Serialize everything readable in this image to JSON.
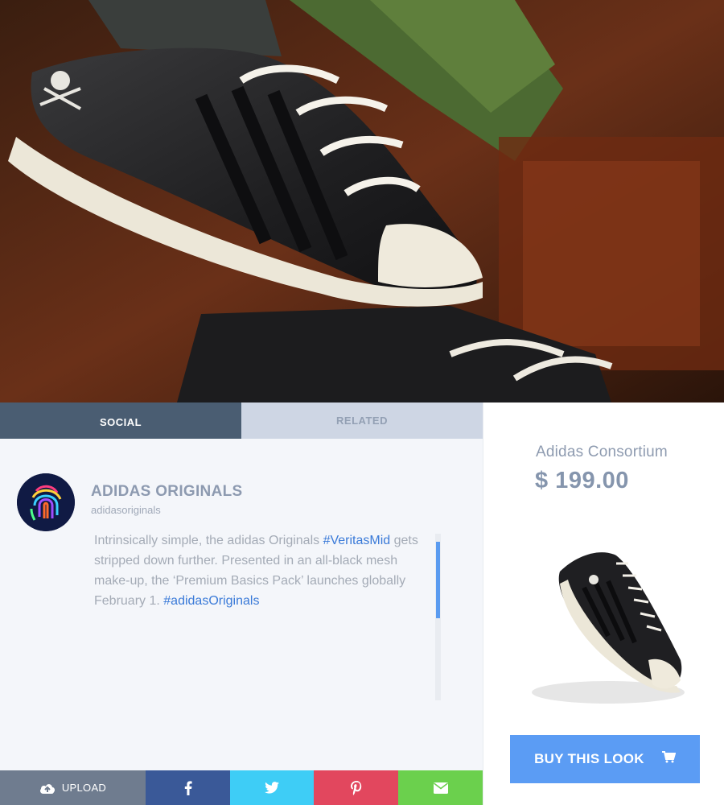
{
  "tabs": {
    "social": "SOCIAL",
    "related": "RELATED"
  },
  "profile": {
    "name": "ADIDAS ORIGINALS",
    "handle": "adidasoriginals"
  },
  "post": {
    "text_1": "Intrinsically simple, the adidas Originals ",
    "tag_1": "#VeritasMid",
    "text_2": " gets stripped down further. Presented in an all-black mesh make-up, the ‘Premium Basics Pack’ launches globally February 1. ",
    "tag_2": "#adidasOriginals"
  },
  "share": {
    "upload_label": "UPLOAD"
  },
  "product": {
    "name": "Adidas Consortium",
    "price": "$ 199.00",
    "buy_label": "BUY THIS LOOK"
  },
  "icons": {
    "upload": "cloud-upload-icon",
    "facebook": "facebook-icon",
    "twitter": "twitter-icon",
    "pinterest": "pinterest-icon",
    "mail": "envelope-icon",
    "cart": "cart-icon"
  },
  "colors": {
    "tab_active": "#4a5d72",
    "tab_inactive": "#ced6e4",
    "hashtag": "#3a7ad8",
    "buy_button": "#5b9cf4",
    "facebook": "#3a5998",
    "twitter": "#3ecdf6",
    "pinterest": "#e2475e",
    "mail": "#6bd04d",
    "upload": "#6f7c8f"
  }
}
